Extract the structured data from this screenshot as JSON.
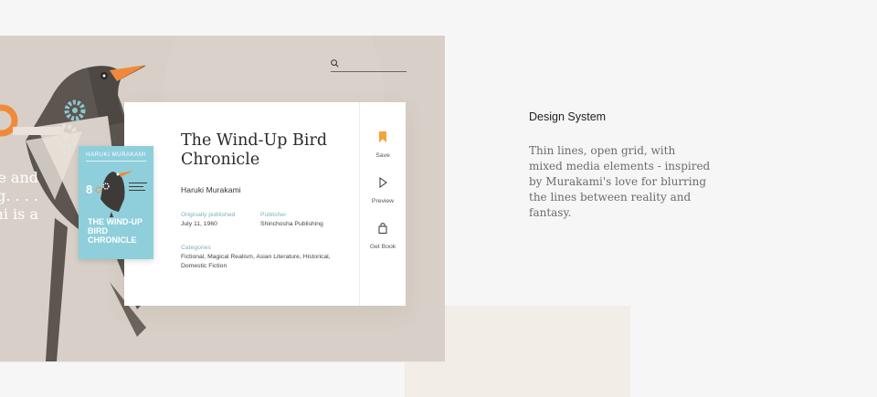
{
  "hero": {
    "background_text": [
      "ke and",
      "ng. . . .",
      "mi is a"
    ]
  },
  "search": {
    "icon": "search-icon"
  },
  "book": {
    "title": "The Wind-Up Bird Chronicle",
    "author": "Haruki Murakami",
    "originally_published_label": "Originally published",
    "originally_published": "July 11, 1960",
    "publisher_label": "Publisher",
    "publisher": "Shinchosha Publishing",
    "categories_label": "Categories",
    "categories": "Fictional, Magical Realism, Asian Literature, Historical, Domestic Fiction",
    "cover": {
      "author": "HARUKI MURAKAMI",
      "title": "THE WIND-UP BIRD CHRONICLE"
    }
  },
  "actions": [
    {
      "label": "Save",
      "icon": "bookmark-icon"
    },
    {
      "label": "Preview",
      "icon": "play-icon"
    },
    {
      "label": "Get Book",
      "icon": "shopping-bag-icon"
    }
  ],
  "design_system": {
    "heading": "Design System",
    "body": "Thin lines, open grid, with mixed media elements - inspired by Murakami's love for blurring the lines between reality and fantasy."
  },
  "colors": {
    "accent_orange": "#f08a3a",
    "label_teal": "#7fb1c0",
    "cover_blue": "#8fcfdb",
    "bookmark": "#f2a43a"
  }
}
